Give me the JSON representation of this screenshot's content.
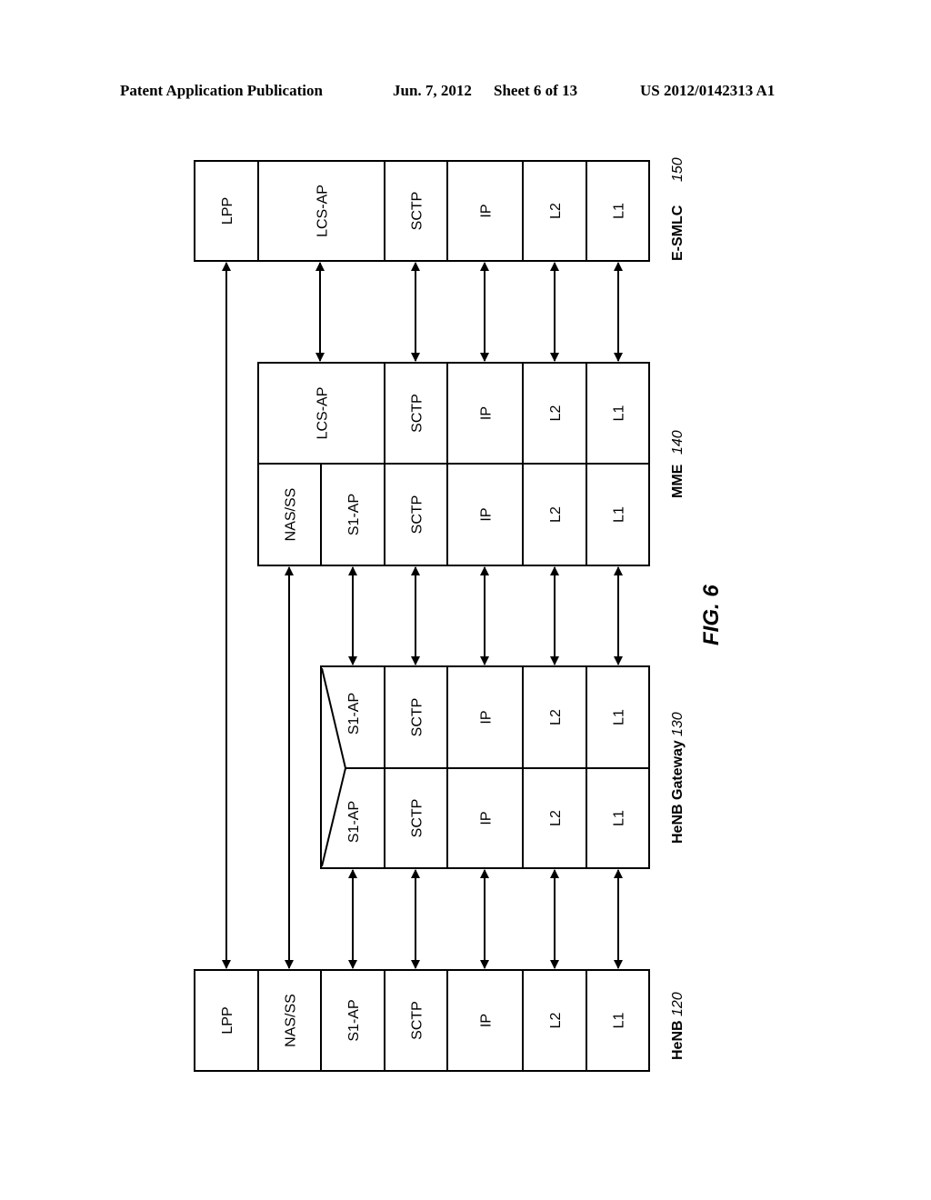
{
  "header": {
    "publication": "Patent Application Publication",
    "date": "Jun. 7, 2012",
    "sheet": "Sheet 6 of 13",
    "number": "US 2012/0142313 A1"
  },
  "figure": {
    "label": "FIG. 6"
  },
  "nodes": {
    "esmlc": {
      "name": "E-SMLC",
      "ref": "150",
      "layers": [
        "LPP",
        "LCS-AP",
        "SCTP",
        "IP",
        "L2",
        "L1"
      ]
    },
    "mme": {
      "name": "MME",
      "ref": "140",
      "upper_layers": [
        "LCS-AP",
        "SCTP",
        "IP",
        "L2",
        "L1"
      ],
      "lower_layers": [
        "NAS/SS",
        "S1-AP",
        "SCTP",
        "IP",
        "L2",
        "L1"
      ]
    },
    "henb_gw": {
      "name": "HeNB Gateway",
      "ref": "130",
      "upper_layers": [
        "S1-AP",
        "SCTP",
        "IP",
        "L2",
        "L1"
      ],
      "lower_layers": [
        "S1-AP",
        "SCTP",
        "IP",
        "L2",
        "L1"
      ]
    },
    "henb": {
      "name": "HeNB",
      "ref": "120",
      "layers": [
        "LPP",
        "NAS/SS",
        "S1-AP",
        "SCTP",
        "IP",
        "L2",
        "L1"
      ]
    }
  },
  "links": [
    {
      "from": "HeNB",
      "to": "E-SMLC",
      "layer": "LPP"
    },
    {
      "from": "HeNB",
      "to": "MME",
      "layer": "NAS/SS"
    },
    {
      "from": "HeNB",
      "to": "HeNB Gateway",
      "layer": "S1-AP"
    },
    {
      "from": "HeNB",
      "to": "HeNB Gateway",
      "layer": "SCTP"
    },
    {
      "from": "HeNB",
      "to": "HeNB Gateway",
      "layer": "IP"
    },
    {
      "from": "HeNB",
      "to": "HeNB Gateway",
      "layer": "L2"
    },
    {
      "from": "HeNB",
      "to": "HeNB Gateway",
      "layer": "L1"
    },
    {
      "from": "HeNB Gateway",
      "to": "MME",
      "layer": "S1-AP"
    },
    {
      "from": "HeNB Gateway",
      "to": "MME",
      "layer": "SCTP"
    },
    {
      "from": "HeNB Gateway",
      "to": "MME",
      "layer": "IP"
    },
    {
      "from": "HeNB Gateway",
      "to": "MME",
      "layer": "L2"
    },
    {
      "from": "HeNB Gateway",
      "to": "MME",
      "layer": "L1"
    },
    {
      "from": "MME",
      "to": "E-SMLC",
      "layer": "LCS-AP"
    },
    {
      "from": "MME",
      "to": "E-SMLC",
      "layer": "SCTP"
    },
    {
      "from": "MME",
      "to": "E-SMLC",
      "layer": "IP"
    },
    {
      "from": "MME",
      "to": "E-SMLC",
      "layer": "L2"
    },
    {
      "from": "MME",
      "to": "E-SMLC",
      "layer": "L1"
    }
  ]
}
